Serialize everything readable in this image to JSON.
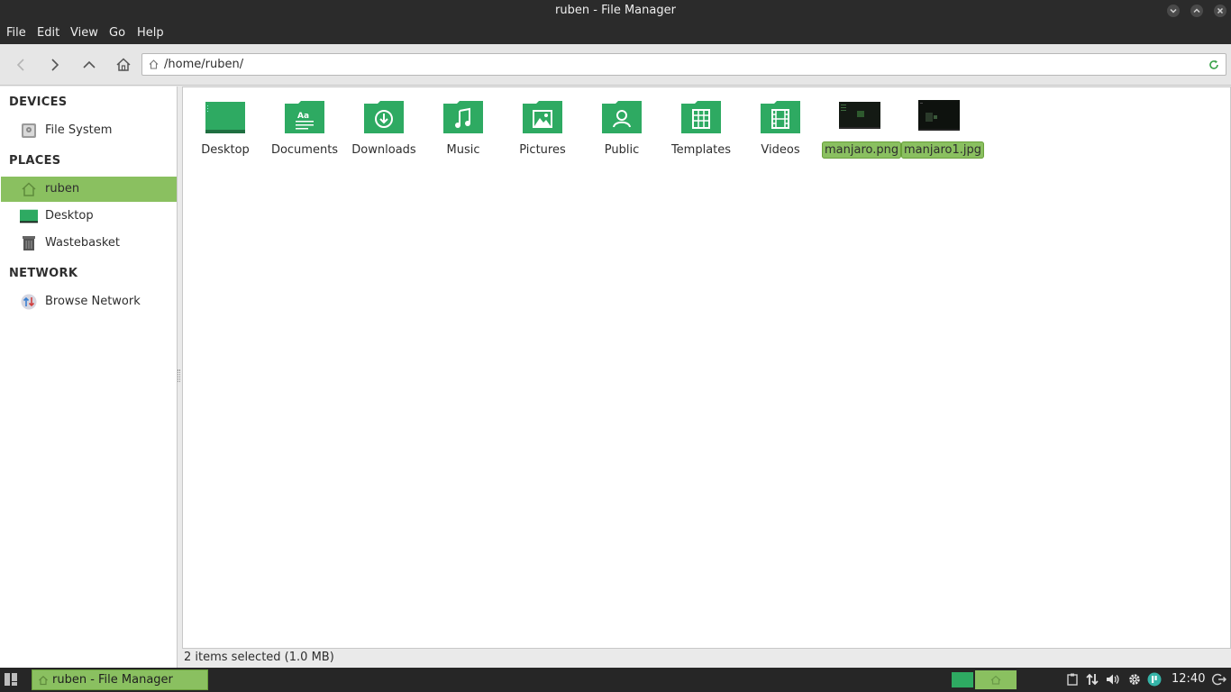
{
  "window": {
    "title": "ruben - File Manager"
  },
  "menu": [
    "File",
    "Edit",
    "View",
    "Go",
    "Help"
  ],
  "location": {
    "path": "/home/ruben/"
  },
  "sidebar": {
    "devices_heading": "DEVICES",
    "devices": [
      {
        "label": "File System",
        "icon": "harddisk-icon"
      }
    ],
    "places_heading": "PLACES",
    "places": [
      {
        "label": "ruben",
        "icon": "home-icon",
        "selected": true
      },
      {
        "label": "Desktop",
        "icon": "desktop-icon"
      },
      {
        "label": "Wastebasket",
        "icon": "trash-icon"
      }
    ],
    "network_heading": "NETWORK",
    "network": [
      {
        "label": "Browse Network",
        "icon": "network-icon"
      }
    ]
  },
  "files": [
    {
      "name": "Desktop",
      "icon": "desktop-folder-icon"
    },
    {
      "name": "Documents",
      "icon": "documents-folder-icon"
    },
    {
      "name": "Downloads",
      "icon": "downloads-folder-icon"
    },
    {
      "name": "Music",
      "icon": "music-folder-icon"
    },
    {
      "name": "Pictures",
      "icon": "pictures-folder-icon"
    },
    {
      "name": "Public",
      "icon": "public-folder-icon"
    },
    {
      "name": "Templates",
      "icon": "templates-folder-icon"
    },
    {
      "name": "Videos",
      "icon": "videos-folder-icon"
    },
    {
      "name": "manjaro.png",
      "icon": "image-thumbnail-icon",
      "selected": true
    },
    {
      "name": "manjaro1.jpg",
      "icon": "image-thumbnail-icon",
      "selected": true
    }
  ],
  "status": {
    "text": "2 items selected (1.0 MB)"
  },
  "taskbar": {
    "task_label": "ruben - File Manager",
    "clock": "12:40"
  },
  "colors": {
    "accent": "#8ac060",
    "folder_green": "#2eaa62",
    "dark_bar": "#2b2b2b"
  }
}
